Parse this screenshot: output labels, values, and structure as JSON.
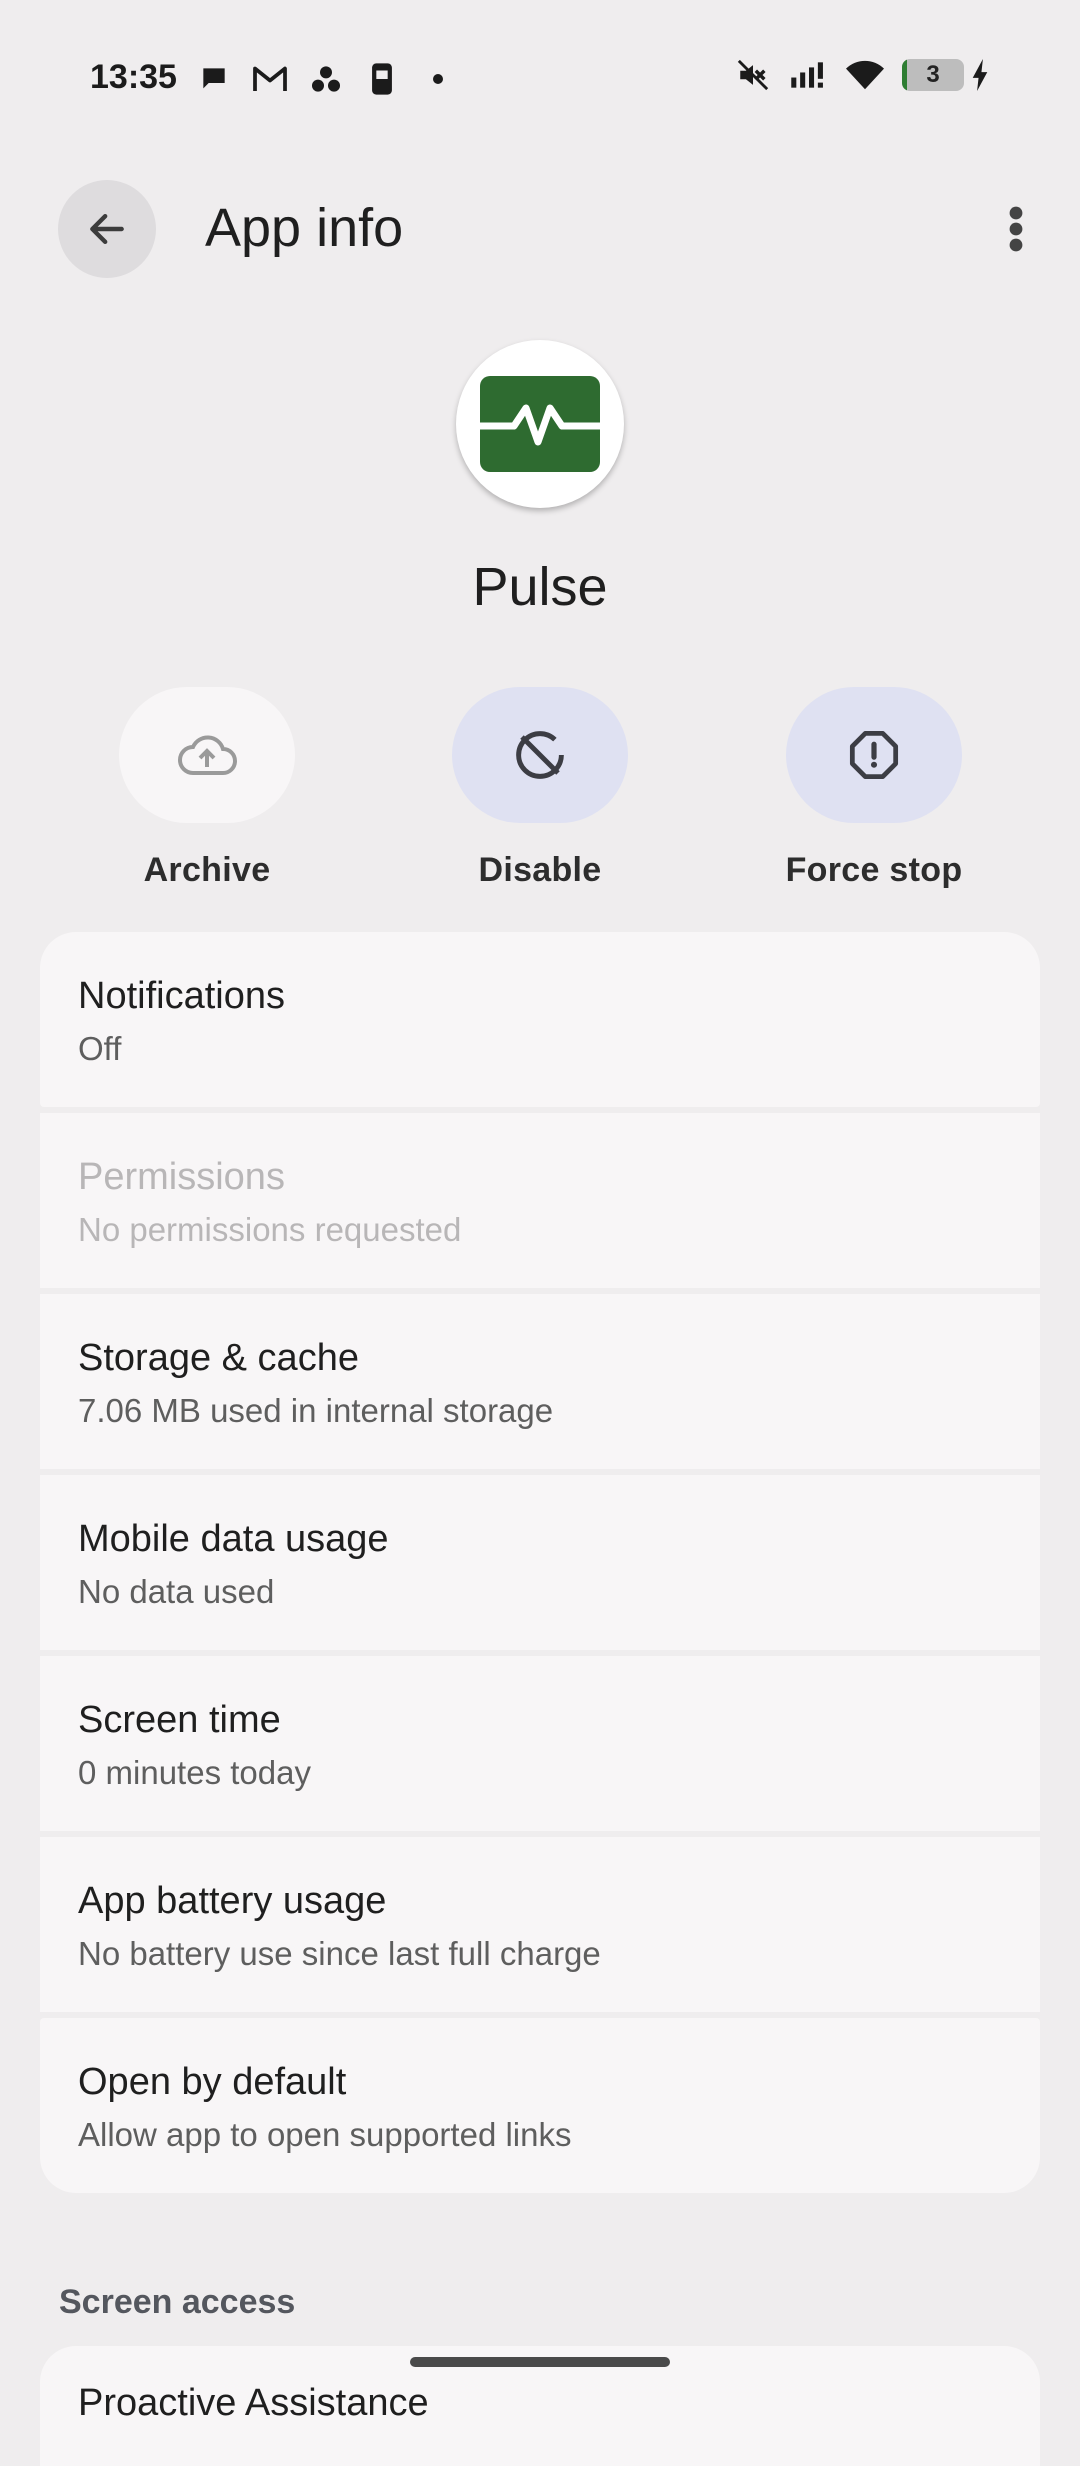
{
  "status_bar": {
    "time": "13:35",
    "left_icons": [
      "chat-icon",
      "gmail-icon",
      "cluster-icon",
      "device-icon",
      "dot-icon"
    ],
    "right_icons": [
      "mute-icon",
      "signal-icon",
      "wifi-icon"
    ],
    "battery_level": "3",
    "battery_charging": true
  },
  "app_bar": {
    "title": "App info"
  },
  "app": {
    "name": "Pulse",
    "icon_color": "#2e6b30"
  },
  "actions": [
    {
      "label": "Archive",
      "icon": "cloud-upload-icon",
      "bg": "#f8f6f7"
    },
    {
      "label": "Disable",
      "icon": "disable-icon",
      "bg": "#dfe1f2"
    },
    {
      "label": "Force stop",
      "icon": "force-stop-icon",
      "bg": "#dfe1f2"
    }
  ],
  "settings": [
    {
      "title": "Notifications",
      "subtitle": "Off"
    },
    {
      "title": "Permissions",
      "subtitle": "No permissions requested",
      "enabled": false
    },
    {
      "title": "Storage & cache",
      "subtitle": "7.06 MB used in internal storage"
    },
    {
      "title": "Mobile data usage",
      "subtitle": "No data used"
    },
    {
      "title": "Screen time",
      "subtitle": "0 minutes today"
    },
    {
      "title": "App battery usage",
      "subtitle": "No battery use since last full charge"
    },
    {
      "title": "Open by default",
      "subtitle": "Allow app to open supported links"
    }
  ],
  "screen_access": {
    "header": "Screen access",
    "first_item": "Proactive Assistance"
  }
}
